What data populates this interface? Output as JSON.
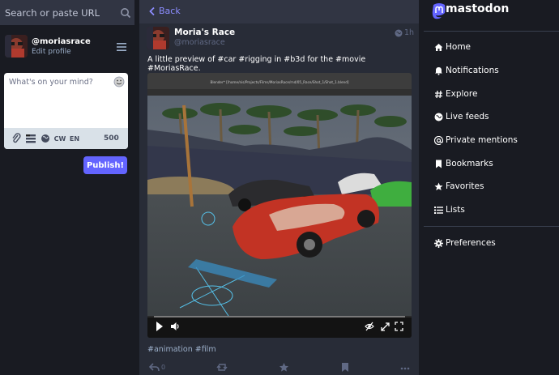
{
  "search": {
    "placeholder": "Search or paste URL",
    "icon": "search-icon"
  },
  "compose_profile": {
    "handle": "@moriasrace",
    "edit_label": "Edit profile"
  },
  "composer": {
    "placeholder": "What's on your mind?",
    "cw_label": "CW",
    "lang_label": "EN",
    "char_count": "500",
    "publish_label": "Publish!"
  },
  "column_header": {
    "back_label": "Back"
  },
  "status": {
    "display_name": "Moria's Race",
    "acct": "@moriasrace",
    "time": "1h",
    "text": "A little preview of #car #rigging in #b3d for the #movie #MoriasRace.",
    "hashtags": "#animation #film",
    "reply_count": "0",
    "video": {
      "window_title": "Blender* [/home/nis/Projects/Films/MoriasRace/rnd/05_Race/Shot_1/Shot_1.blend]",
      "progress": 0.0
    }
  },
  "brand": {
    "name": "mastodon",
    "accent": "#6364ff"
  },
  "nav": {
    "items": [
      {
        "label": "Home",
        "icon": "home-icon"
      },
      {
        "label": "Notifications",
        "icon": "bell-icon"
      },
      {
        "label": "Explore",
        "icon": "hashtag-icon"
      },
      {
        "label": "Live feeds",
        "icon": "globe-icon"
      },
      {
        "label": "Private mentions",
        "icon": "at-icon"
      },
      {
        "label": "Bookmarks",
        "icon": "bookmark-icon"
      },
      {
        "label": "Favorites",
        "icon": "star-icon"
      },
      {
        "label": "Lists",
        "icon": "list-icon"
      }
    ],
    "preferences_label": "Preferences"
  }
}
